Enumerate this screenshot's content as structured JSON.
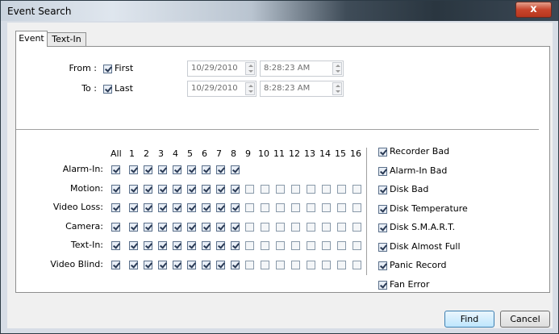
{
  "window": {
    "title": "Event Search",
    "close_glyph": "x"
  },
  "tabs": [
    "Event",
    "Text-In"
  ],
  "from": {
    "label": "From :",
    "checkbox_label": "First",
    "checked": true,
    "date": "10/29/2010",
    "time": "8:28:23 AM"
  },
  "to": {
    "label": "To :",
    "checkbox_label": "Last",
    "checked": true,
    "date": "10/29/2010",
    "time": "8:28:23 AM"
  },
  "grid": {
    "all_label": "All",
    "columns": [
      "1",
      "2",
      "3",
      "4",
      "5",
      "6",
      "7",
      "8",
      "9",
      "10",
      "11",
      "12",
      "13",
      "14",
      "15",
      "16"
    ],
    "rows": [
      {
        "label": "Alarm-In:",
        "all": true,
        "values": [
          true,
          true,
          true,
          true,
          true,
          true,
          true,
          true
        ]
      },
      {
        "label": "Motion:",
        "all": true,
        "values": [
          true,
          true,
          true,
          true,
          true,
          true,
          true,
          true,
          false,
          false,
          false,
          false,
          false,
          false,
          false,
          false
        ]
      },
      {
        "label": "Video Loss:",
        "all": true,
        "values": [
          true,
          true,
          true,
          true,
          true,
          true,
          true,
          true,
          false,
          false,
          false,
          false,
          false,
          false,
          false,
          false
        ]
      },
      {
        "label": "Camera:",
        "all": true,
        "values": [
          true,
          true,
          true,
          true,
          true,
          true,
          true,
          true,
          false,
          false,
          false,
          false,
          false,
          false,
          false,
          false
        ]
      },
      {
        "label": "Text-In:",
        "all": true,
        "values": [
          true,
          true,
          true,
          true,
          true,
          true,
          true,
          true,
          false,
          false,
          false,
          false,
          false,
          false,
          false,
          false
        ]
      },
      {
        "label": "Video Blind:",
        "all": true,
        "values": [
          true,
          true,
          true,
          true,
          true,
          true,
          true,
          true,
          false,
          false,
          false,
          false,
          false,
          false,
          false,
          false
        ]
      }
    ]
  },
  "system_events": [
    {
      "label": "Recorder Bad",
      "checked": true
    },
    {
      "label": "Alarm-In Bad",
      "checked": true
    },
    {
      "label": "Disk Bad",
      "checked": true
    },
    {
      "label": "Disk Temperature",
      "checked": true
    },
    {
      "label": "Disk S.M.A.R.T.",
      "checked": true
    },
    {
      "label": "Disk Almost Full",
      "checked": true
    },
    {
      "label": "Panic Record",
      "checked": true
    },
    {
      "label": "Fan Error",
      "checked": true
    }
  ],
  "buttons": {
    "find": "Find",
    "cancel": "Cancel"
  },
  "colors": {
    "accent": "#3c7fb1",
    "close": "#c8452c"
  }
}
